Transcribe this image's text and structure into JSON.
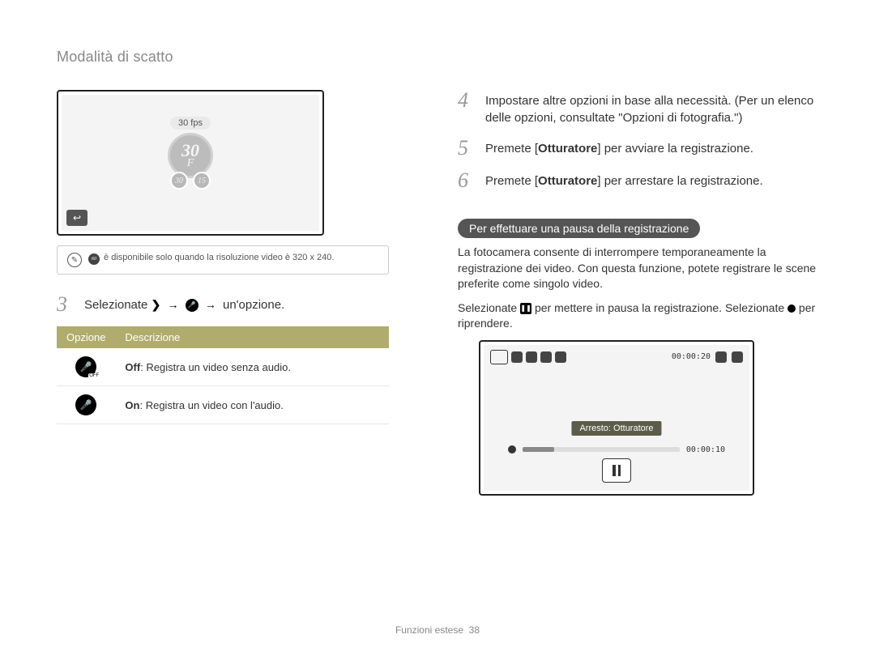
{
  "header": {
    "title": "Modalità di scatto"
  },
  "left": {
    "lcd1": {
      "fps_label": "30 fps",
      "fps_big": "30",
      "fps_small_1": "30",
      "fps_small_2": "15"
    },
    "note": " è disponibile solo quando la risoluzione video è 320 x 240.",
    "step3": {
      "num": "3",
      "text_prefix": "Selezionate ",
      "text_suffix": " un'opzione."
    },
    "table": {
      "head_option": "Opzione",
      "head_desc": "Descrizione",
      "rows": [
        {
          "bold": "Off",
          "rest": ": Registra un video senza audio."
        },
        {
          "bold": "On",
          "rest": ": Registra un video con l'audio."
        }
      ]
    }
  },
  "right": {
    "step4": {
      "num": "4",
      "text": "Impostare altre opzioni in base alla necessità. (Per un elenco delle opzioni, consultate \"Opzioni di fotografia.\")"
    },
    "step5": {
      "num": "5",
      "pre": "Premete [",
      "bold": "Otturatore",
      "post": "] per avviare la registrazione."
    },
    "step6": {
      "num": "6",
      "pre": "Premete [",
      "bold": "Otturatore",
      "post": "] per arrestare la registrazione."
    },
    "section_title": "Per effettuare una pausa della registrazione",
    "para1": "La fotocamera consente di interrompere temporaneamente la registrazione dei video. Con questa funzione, potete registrare le scene preferite come singolo video.",
    "para2_pre": "Selezionate ",
    "para2_mid": " per mettere in pausa la registrazione. Selezionate ",
    "para2_post": " per riprendere.",
    "lcd2": {
      "timer_top": "00:00:20",
      "tag": "Arresto: Otturatore",
      "timer_bar": "00:00:10"
    }
  },
  "footer": {
    "section": "Funzioni estese",
    "page": "38"
  }
}
